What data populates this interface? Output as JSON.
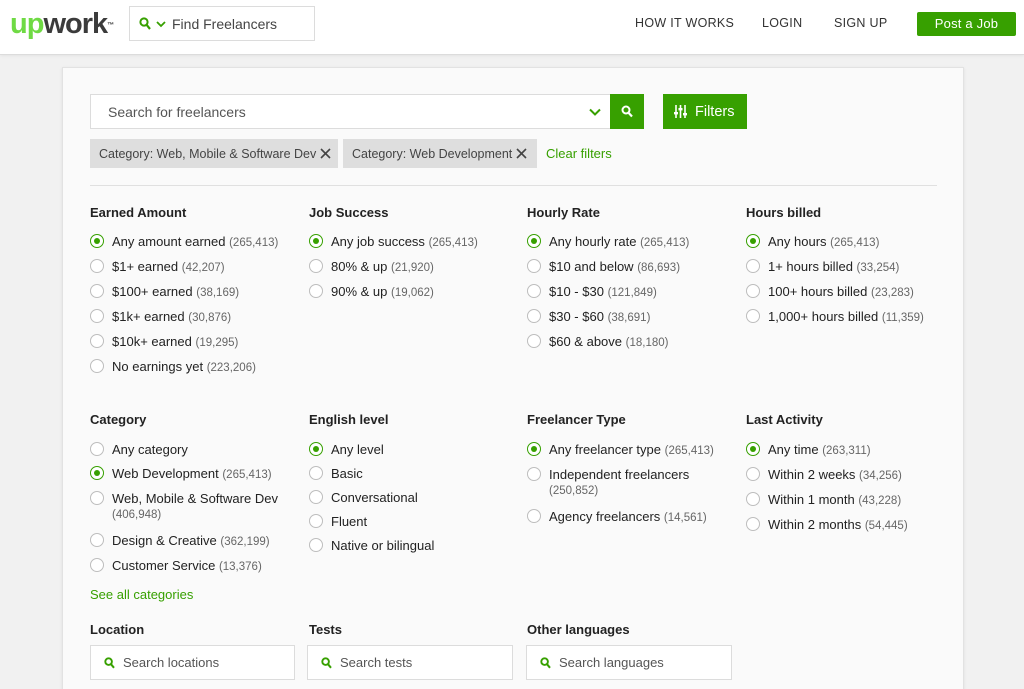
{
  "header": {
    "logo_up": "up",
    "logo_work": "work",
    "logo_tm": "™",
    "search_scope": "Find Freelancers",
    "nav": [
      "HOW IT WORKS",
      "LOGIN",
      "SIGN UP"
    ],
    "post_job": "Post a Job"
  },
  "search": {
    "placeholder": "Search for freelancers",
    "filters_label": "Filters"
  },
  "chips": [
    "Category: Web, Mobile & Software Dev",
    "Category: Web Development"
  ],
  "clear_filters": "Clear filters",
  "filters": {
    "earned": {
      "title": "Earned Amount",
      "options": [
        {
          "label": "Any amount earned",
          "count": "(265,413)",
          "selected": true
        },
        {
          "label": "$1+ earned",
          "count": "(42,207)"
        },
        {
          "label": "$100+ earned",
          "count": "(38,169)"
        },
        {
          "label": "$1k+ earned",
          "count": "(30,876)"
        },
        {
          "label": "$10k+ earned",
          "count": "(19,295)"
        },
        {
          "label": "No earnings yet",
          "count": "(223,206)"
        }
      ]
    },
    "job_success": {
      "title": "Job Success",
      "options": [
        {
          "label": "Any job success",
          "count": "(265,413)",
          "selected": true
        },
        {
          "label": "80% & up",
          "count": "(21,920)"
        },
        {
          "label": "90% & up",
          "count": "(19,062)"
        }
      ]
    },
    "hourly_rate": {
      "title": "Hourly Rate",
      "options": [
        {
          "label": "Any hourly rate",
          "count": "(265,413)",
          "selected": true
        },
        {
          "label": "$10 and below",
          "count": "(86,693)"
        },
        {
          "label": "$10 - $30",
          "count": "(121,849)"
        },
        {
          "label": "$30 - $60",
          "count": "(38,691)"
        },
        {
          "label": "$60 & above",
          "count": "(18,180)"
        }
      ]
    },
    "hours_billed": {
      "title": "Hours billed",
      "options": [
        {
          "label": "Any hours",
          "count": "(265,413)",
          "selected": true
        },
        {
          "label": "1+ hours billed",
          "count": "(33,254)"
        },
        {
          "label": "100+ hours billed",
          "count": "(23,283)"
        },
        {
          "label": "1,000+ hours billed",
          "count": "(11,359)"
        }
      ]
    },
    "category": {
      "title": "Category",
      "options": [
        {
          "label": "Any category"
        },
        {
          "label": "Web Development",
          "count": "(265,413)",
          "selected": true
        },
        {
          "label": "Web, Mobile & Software Dev",
          "count": "(406,948)"
        },
        {
          "label": "Design & Creative",
          "count": "(362,199)"
        },
        {
          "label": "Customer Service",
          "count": "(13,376)"
        }
      ],
      "see_all": "See all categories"
    },
    "english": {
      "title": "English level",
      "options": [
        {
          "label": "Any level",
          "selected": true
        },
        {
          "label": "Basic"
        },
        {
          "label": "Conversational"
        },
        {
          "label": "Fluent"
        },
        {
          "label": "Native or bilingual"
        }
      ]
    },
    "freelancer_type": {
      "title": "Freelancer Type",
      "options": [
        {
          "label": "Any freelancer type",
          "count": "(265,413)",
          "selected": true
        },
        {
          "label": "Independent freelancers",
          "count": "(250,852)"
        },
        {
          "label": "Agency freelancers",
          "count": "(14,561)"
        }
      ]
    },
    "last_activity": {
      "title": "Last Activity",
      "options": [
        {
          "label": "Any time",
          "count": "(263,311)",
          "selected": true
        },
        {
          "label": "Within 2 weeks",
          "count": "(34,256)"
        },
        {
          "label": "Within 1 month",
          "count": "(43,228)"
        },
        {
          "label": "Within 2 months",
          "count": "(54,445)"
        }
      ]
    },
    "location": {
      "title": "Location",
      "placeholder": "Search locations"
    },
    "tests": {
      "title": "Tests",
      "placeholder": "Search tests"
    },
    "languages": {
      "title": "Other languages",
      "placeholder": "Search languages"
    }
  },
  "colors": {
    "accent": "#37a000",
    "logo_green": "#6fda44"
  },
  "icons": [
    "search-icon",
    "chevron-down-icon",
    "sliders-icon",
    "close-icon"
  ]
}
